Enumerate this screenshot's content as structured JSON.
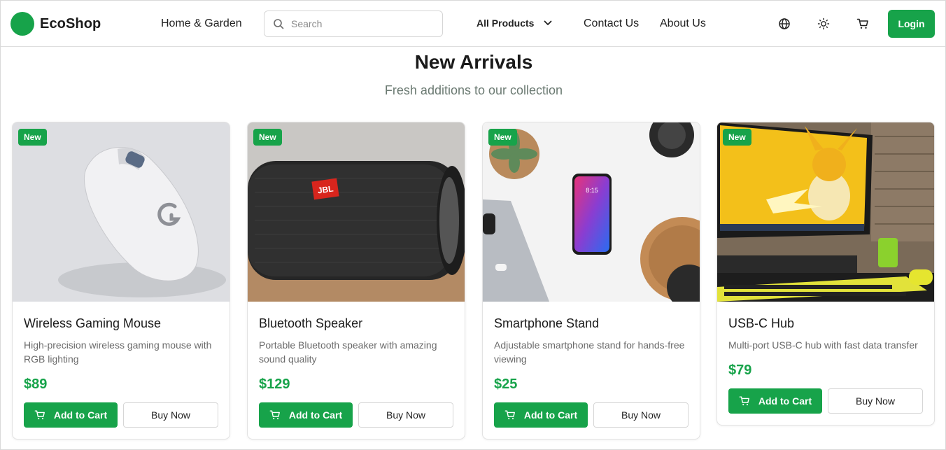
{
  "brand": {
    "name": "EcoShop",
    "color": "#17a34a"
  },
  "nav": {
    "home_garden": "Home & Garden",
    "search_placeholder": "Search",
    "all_products": "All Products",
    "contact": "Contact Us",
    "about": "About Us",
    "login": "Login"
  },
  "icons": [
    "search-icon",
    "chevron-down-icon",
    "globe-icon",
    "sun-icon",
    "cart-icon"
  ],
  "section": {
    "title": "New Arrivals",
    "subtitle": "Fresh additions to our collection"
  },
  "products": [
    {
      "badge": "New",
      "name": "Wireless Gaming Mouse",
      "description": "High-precision wireless gaming mouse with RGB lighting",
      "price": "$89",
      "add_to_cart": "Add to Cart",
      "buy_now": "Buy Now"
    },
    {
      "badge": "New",
      "name": "Bluetooth Speaker",
      "description": "Portable Bluetooth speaker with amazing sound quality",
      "price": "$129",
      "add_to_cart": "Add to Cart",
      "buy_now": "Buy Now"
    },
    {
      "badge": "New",
      "name": "Smartphone Stand",
      "description": "Adjustable smartphone stand for hands-free viewing",
      "price": "$25",
      "add_to_cart": "Add to Cart",
      "buy_now": "Buy Now"
    },
    {
      "badge": "New",
      "name": "USB-C Hub",
      "description": "Multi-port USB-C hub with fast data transfer",
      "price": "$79",
      "add_to_cart": "Add to Cart",
      "buy_now": "Buy Now"
    }
  ],
  "image_text": {
    "speaker_logo": "JBL",
    "phone_time": "8:15"
  }
}
